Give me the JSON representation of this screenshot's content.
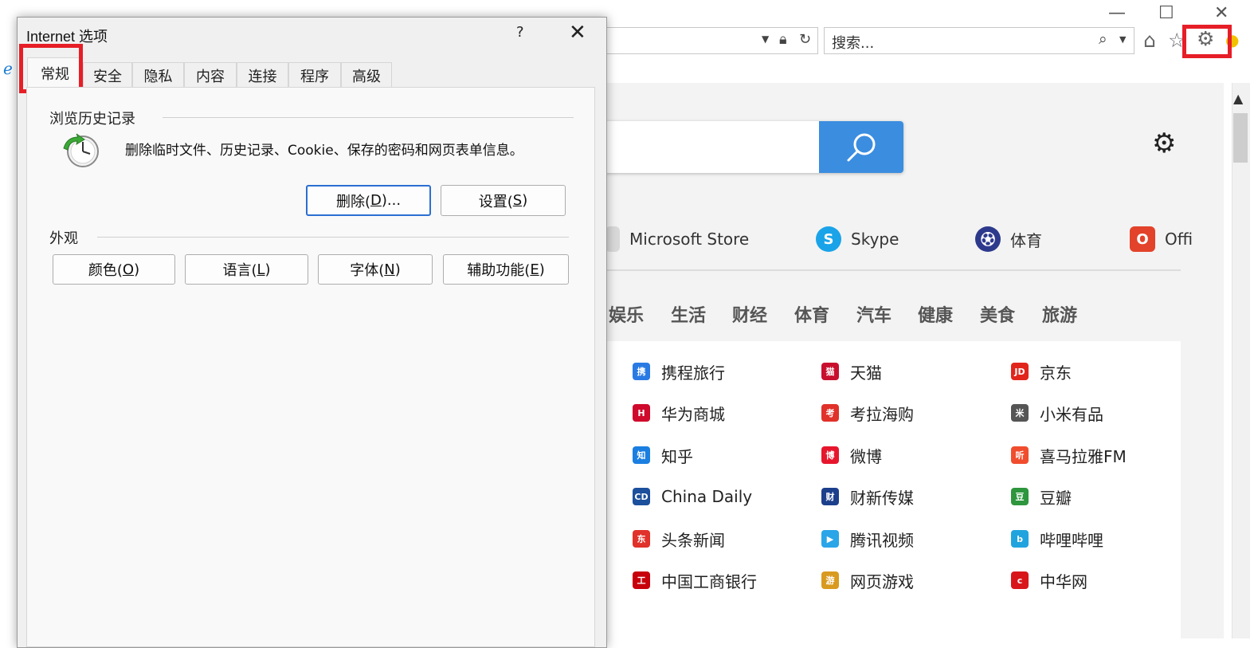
{
  "browser": {
    "search_placeholder": "搜索...",
    "window_controls": {
      "minimize": "—",
      "maximize": "☐",
      "close": "✕"
    }
  },
  "page": {
    "quick_links": [
      {
        "label": "Microsoft Store",
        "icon": "store-icon",
        "color": "#7a7a7a"
      },
      {
        "label": "Skype",
        "icon": "skype-icon",
        "color": "#1aa3e8"
      },
      {
        "label": "体育",
        "icon": "sports-ball-icon",
        "color": "#2d3a8c"
      },
      {
        "label": "Offi",
        "icon": "office-icon",
        "color": "#e2432a"
      }
    ],
    "categories": [
      "娱乐",
      "生活",
      "财经",
      "体育",
      "汽车",
      "健康",
      "美食",
      "旅游"
    ],
    "links": [
      {
        "label": "携程旅行",
        "color": "#2a7ae4",
        "glyph": "携"
      },
      {
        "label": "天猫",
        "color": "#c8102e",
        "glyph": "猫"
      },
      {
        "label": "京东",
        "color": "#e1251b",
        "glyph": "JD"
      },
      {
        "label": "华为商城",
        "color": "#cf0a2c",
        "glyph": "H"
      },
      {
        "label": "考拉海购",
        "color": "#e0312a",
        "glyph": "考"
      },
      {
        "label": "小米有品",
        "color": "#555555",
        "glyph": "米"
      },
      {
        "label": "知乎",
        "color": "#1a7fe0",
        "glyph": "知"
      },
      {
        "label": "微博",
        "color": "#e6162d",
        "glyph": "博"
      },
      {
        "label": "喜马拉雅FM",
        "color": "#f04d2e",
        "glyph": "听"
      },
      {
        "label": "China Daily",
        "color": "#1c4f9c",
        "glyph": "CD"
      },
      {
        "label": "财新传媒",
        "color": "#1c3f8c",
        "glyph": "财"
      },
      {
        "label": "豆瓣",
        "color": "#2e963d",
        "glyph": "豆"
      },
      {
        "label": "头条新闻",
        "color": "#e0312a",
        "glyph": "东"
      },
      {
        "label": "腾讯视频",
        "color": "#2aa5e8",
        "glyph": "▶"
      },
      {
        "label": "哔哩哔哩",
        "color": "#21a4de",
        "glyph": "b"
      },
      {
        "label": "中国工商银行",
        "color": "#c7000b",
        "glyph": "工"
      },
      {
        "label": "网页游戏",
        "color": "#d99a20",
        "glyph": "游"
      },
      {
        "label": "中华网",
        "color": "#d8161a",
        "glyph": "c"
      }
    ]
  },
  "dialog": {
    "title": "Internet 选项",
    "help": "?",
    "close": "✕",
    "tabs": [
      "常规",
      "安全",
      "隐私",
      "内容",
      "连接",
      "程序",
      "高级"
    ],
    "history": {
      "heading": "浏览历史记录",
      "description": "删除临时文件、历史记录、Cookie、保存的密码和网页表单信息。",
      "delete_pre": "删除(",
      "delete_key": "D",
      "delete_post": ")...",
      "settings_pre": "设置(",
      "settings_key": "S",
      "settings_post": ")"
    },
    "appearance": {
      "heading": "外观",
      "buttons": [
        {
          "pre": "颜色(",
          "key": "O",
          "post": ")"
        },
        {
          "pre": "语言(",
          "key": "L",
          "post": ")"
        },
        {
          "pre": "字体(",
          "key": "N",
          "post": ")"
        },
        {
          "pre": "辅助功能(",
          "key": "E",
          "post": ")"
        }
      ]
    }
  },
  "colors": {
    "highlight": "#e61e27",
    "accent": "#3b8de0",
    "default_button": "#2b6fd1"
  }
}
